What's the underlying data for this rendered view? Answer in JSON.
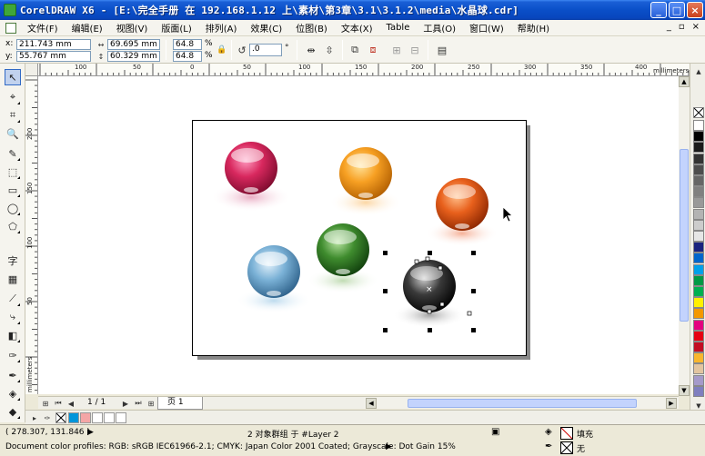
{
  "window": {
    "title": "CorelDRAW X6 - [E:\\完全手册 在 192.168.1.12 上\\素材\\第3章\\3.1\\3.1.2\\media\\水晶球.cdr]",
    "min": "_",
    "max": "□",
    "close": "×"
  },
  "menu": {
    "items": [
      "文件(F)",
      "编辑(E)",
      "视图(V)",
      "版面(L)",
      "排列(A)",
      "效果(C)",
      "位图(B)",
      "文本(X)",
      "Table",
      "工具(O)",
      "窗口(W)",
      "帮助(H)"
    ],
    "doc_min": "_",
    "doc_restore": "▫",
    "doc_close": "×"
  },
  "props": {
    "x_label": "x:",
    "y_label": "y:",
    "x_value": "211.743 mm",
    "y_value": "55.767 mm",
    "w_value": "69.695 mm",
    "h_value": "60.329 mm",
    "scale_w": "64.8",
    "scale_h": "64.8",
    "pct": "%",
    "rotation": ".0",
    "degree": "°"
  },
  "ruler": {
    "h_labels": [
      "100",
      "50",
      "0",
      "50",
      "100",
      "150",
      "200",
      "250",
      "300",
      "350",
      "400"
    ],
    "v_labels": [
      "200",
      "150",
      "100",
      "50"
    ],
    "h_unit": "millimeters",
    "v_unit": "millimeters"
  },
  "pagenav": {
    "counter": "1 / 1",
    "tab": "页 1"
  },
  "status": {
    "coords": "( 278.307, 131.846 )",
    "arrow": "▶",
    "selection": "2 对象群组 于 #Layer 2",
    "profile": "Document color profiles: RGB: sRGB IEC61966-2.1; CMYK: Japan Color 2001 Coated; Grayscale: Dot Gain 15%",
    "fill_label": "填充",
    "outline_label": "无"
  },
  "colors": {
    "title_bar": "#0a4fc8",
    "selection_handle": "#000000"
  },
  "palette": [
    "#ffffff",
    "#000000",
    "#1a1a1a",
    "#333333",
    "#4d4d4d",
    "#666666",
    "#808080",
    "#999999",
    "#b3b3b3",
    "#cccccc",
    "#e6e6e6",
    "#1a237e",
    "#0066cc",
    "#00a0e9",
    "#009944",
    "#00b050",
    "#fff100",
    "#f39800",
    "#e4007f",
    "#e60012",
    "#c30d23",
    "#f8b62d",
    "#e2c5a0",
    "#a59aca",
    "#7f7fbf"
  ],
  "doc_palette": [
    "#0095da",
    "#f4a6a6",
    "#ffffff",
    "#ffffff",
    "#ffffff"
  ]
}
